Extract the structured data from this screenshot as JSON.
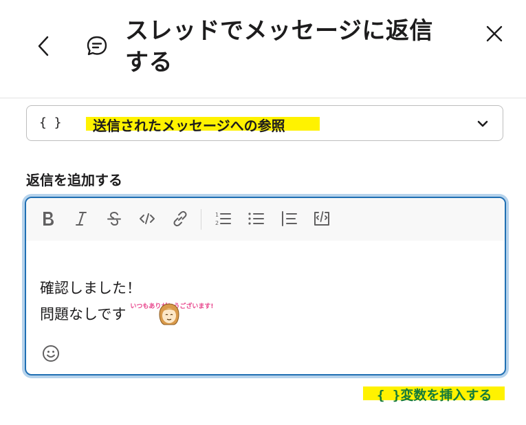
{
  "header": {
    "title": "スレッドでメッセージに返信する"
  },
  "reference_select": {
    "braces": "{ }",
    "label": "送信されたメッセージへの参照"
  },
  "reply": {
    "section_label": "返信を追加する",
    "message_lines": [
      "確認しました！",
      "問題なしです"
    ],
    "sticker_text": "いつもありがとうございます!"
  },
  "insert_variable": {
    "braces": "{ }",
    "label": "変数を挿入する"
  },
  "colors": {
    "highlight": "#fff200",
    "editor_border": "#1f6fb3",
    "link_green": "#147a3a"
  },
  "icons": [
    "back-icon",
    "thread-icon",
    "close-icon",
    "braces-icon",
    "chevron-down-icon",
    "bold-icon",
    "italic-icon",
    "strikethrough-icon",
    "code-icon",
    "link-icon",
    "ordered-list-icon",
    "bulleted-list-icon",
    "quote-icon",
    "code-block-icon",
    "emoji-icon"
  ]
}
